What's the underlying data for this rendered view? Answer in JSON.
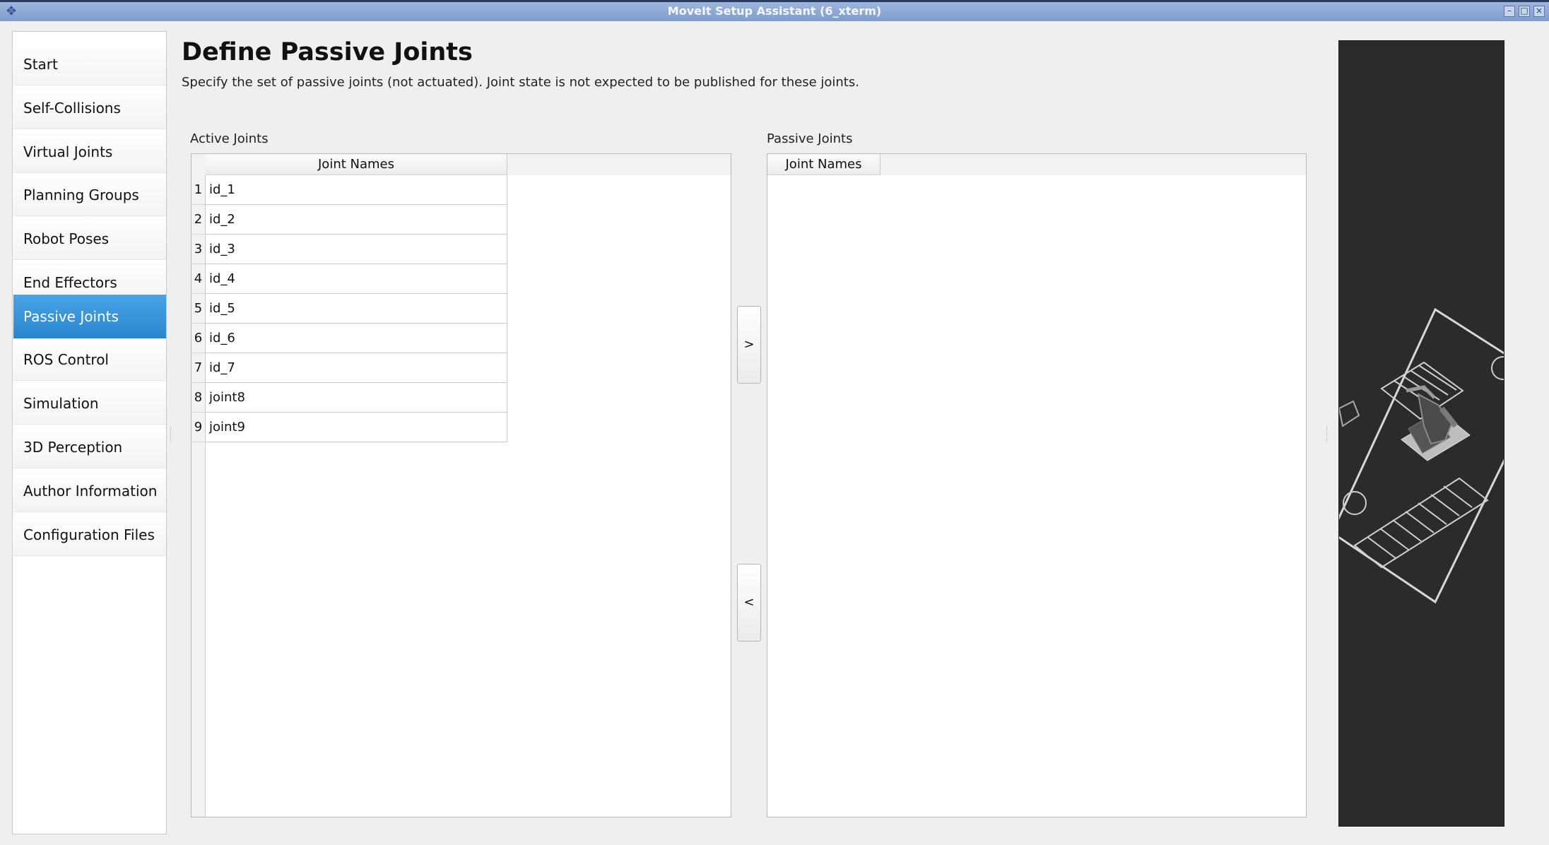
{
  "window": {
    "title": "MoveIt Setup Assistant (6_xterm)",
    "minimize": "–",
    "maximize": "□",
    "close": "×"
  },
  "sidebar": {
    "items": [
      {
        "label": "Start"
      },
      {
        "label": "Self-Collisions"
      },
      {
        "label": "Virtual Joints"
      },
      {
        "label": "Planning Groups"
      },
      {
        "label": "Robot Poses"
      },
      {
        "label": "End Effectors"
      },
      {
        "label": "Passive Joints",
        "active": true
      },
      {
        "label": "ROS Control"
      },
      {
        "label": "Simulation"
      },
      {
        "label": "3D Perception"
      },
      {
        "label": "Author Information"
      },
      {
        "label": "Configuration Files"
      }
    ]
  },
  "main": {
    "title": "Define Passive Joints",
    "description": "Specify the set of passive joints (not actuated). Joint state is not expected to be published for these joints.",
    "active": {
      "label": "Active Joints",
      "column": "Joint Names",
      "rows": [
        {
          "index": "1",
          "name": "id_1"
        },
        {
          "index": "2",
          "name": "id_2"
        },
        {
          "index": "3",
          "name": "id_3"
        },
        {
          "index": "4",
          "name": "id_4"
        },
        {
          "index": "5",
          "name": "id_5"
        },
        {
          "index": "6",
          "name": "id_6"
        },
        {
          "index": "7",
          "name": "id_7"
        },
        {
          "index": "8",
          "name": "joint8"
        },
        {
          "index": "9",
          "name": "joint9"
        }
      ]
    },
    "passive": {
      "label": "Passive Joints",
      "column": "Joint Names",
      "rows": []
    },
    "buttons": {
      "add": ">",
      "remove": "<"
    }
  },
  "colors": {
    "accent": "#2a86d0",
    "viewer_background": "#2b2b2b"
  }
}
